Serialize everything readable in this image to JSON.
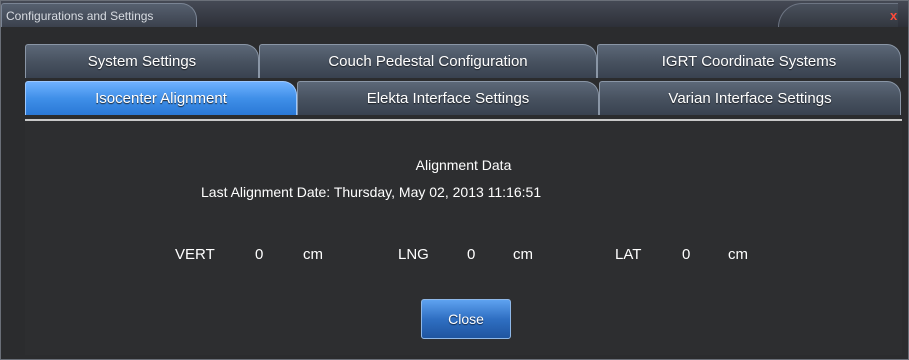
{
  "window": {
    "title": "Configurations and Settings",
    "close_glyph": "x"
  },
  "tabs": {
    "row1": [
      {
        "label": "System Settings"
      },
      {
        "label": "Couch Pedestal Configuration"
      },
      {
        "label": "IGRT Coordinate Systems"
      }
    ],
    "row2": [
      {
        "label": "Isocenter Alignment",
        "active": true
      },
      {
        "label": "Elekta Interface Settings"
      },
      {
        "label": "Varian Interface Settings"
      }
    ]
  },
  "alignment": {
    "heading": "Alignment Data",
    "last_date_label": "Last Alignment Date:",
    "last_date_value": "Thursday, May 02, 2013 11:16:51",
    "coords": [
      {
        "axis": "VERT",
        "value": "0",
        "unit": "cm"
      },
      {
        "axis": "LNG",
        "value": "0",
        "unit": "cm"
      },
      {
        "axis": "LAT",
        "value": "0",
        "unit": "cm"
      }
    ]
  },
  "buttons": {
    "close_label": "Close"
  },
  "colors": {
    "active_tab": "#3f8fe8",
    "close_x": "#ff4a3a",
    "panel_bg": "#2d2e30"
  }
}
